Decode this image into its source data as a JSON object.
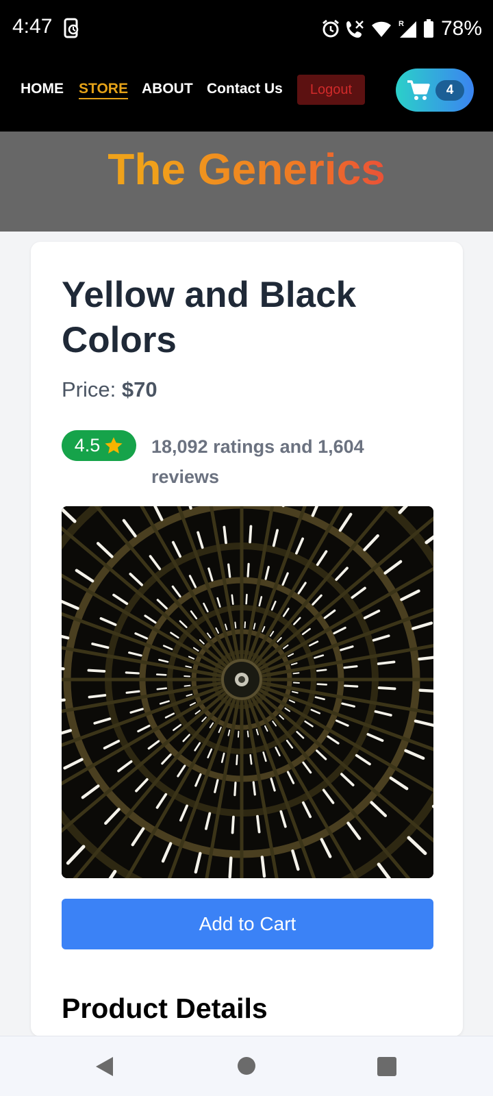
{
  "status_bar": {
    "time": "4:47",
    "battery": "78%",
    "icons": [
      "sync-icon",
      "alarm-icon",
      "wifi-call-icon",
      "wifi-icon",
      "signal-roaming-icon",
      "battery-icon"
    ]
  },
  "nav": {
    "home": "HOME",
    "store": "STORE",
    "about": "ABOUT",
    "contact": "Contact Us",
    "logout": "Logout",
    "cart_count": "4",
    "active": "STORE",
    "active_color": "#e5a218"
  },
  "hero": {
    "title": "The Generics"
  },
  "product": {
    "title": "Yellow and Black Colors",
    "price_label": "Price:",
    "price_value": "$70",
    "rating": "4.5",
    "ratings_text": "18,092 ratings and 1,604 reviews",
    "add_to_cart": "Add to Cart",
    "details_heading": "Product Details"
  },
  "colors": {
    "rating_badge": "#16a34a",
    "add_to_cart": "#3b82f6",
    "logout_bg": "#5c1111",
    "logout_text": "#d12a2a"
  },
  "system_nav": {
    "icons": [
      "back-icon",
      "home-icon",
      "recents-icon"
    ]
  }
}
